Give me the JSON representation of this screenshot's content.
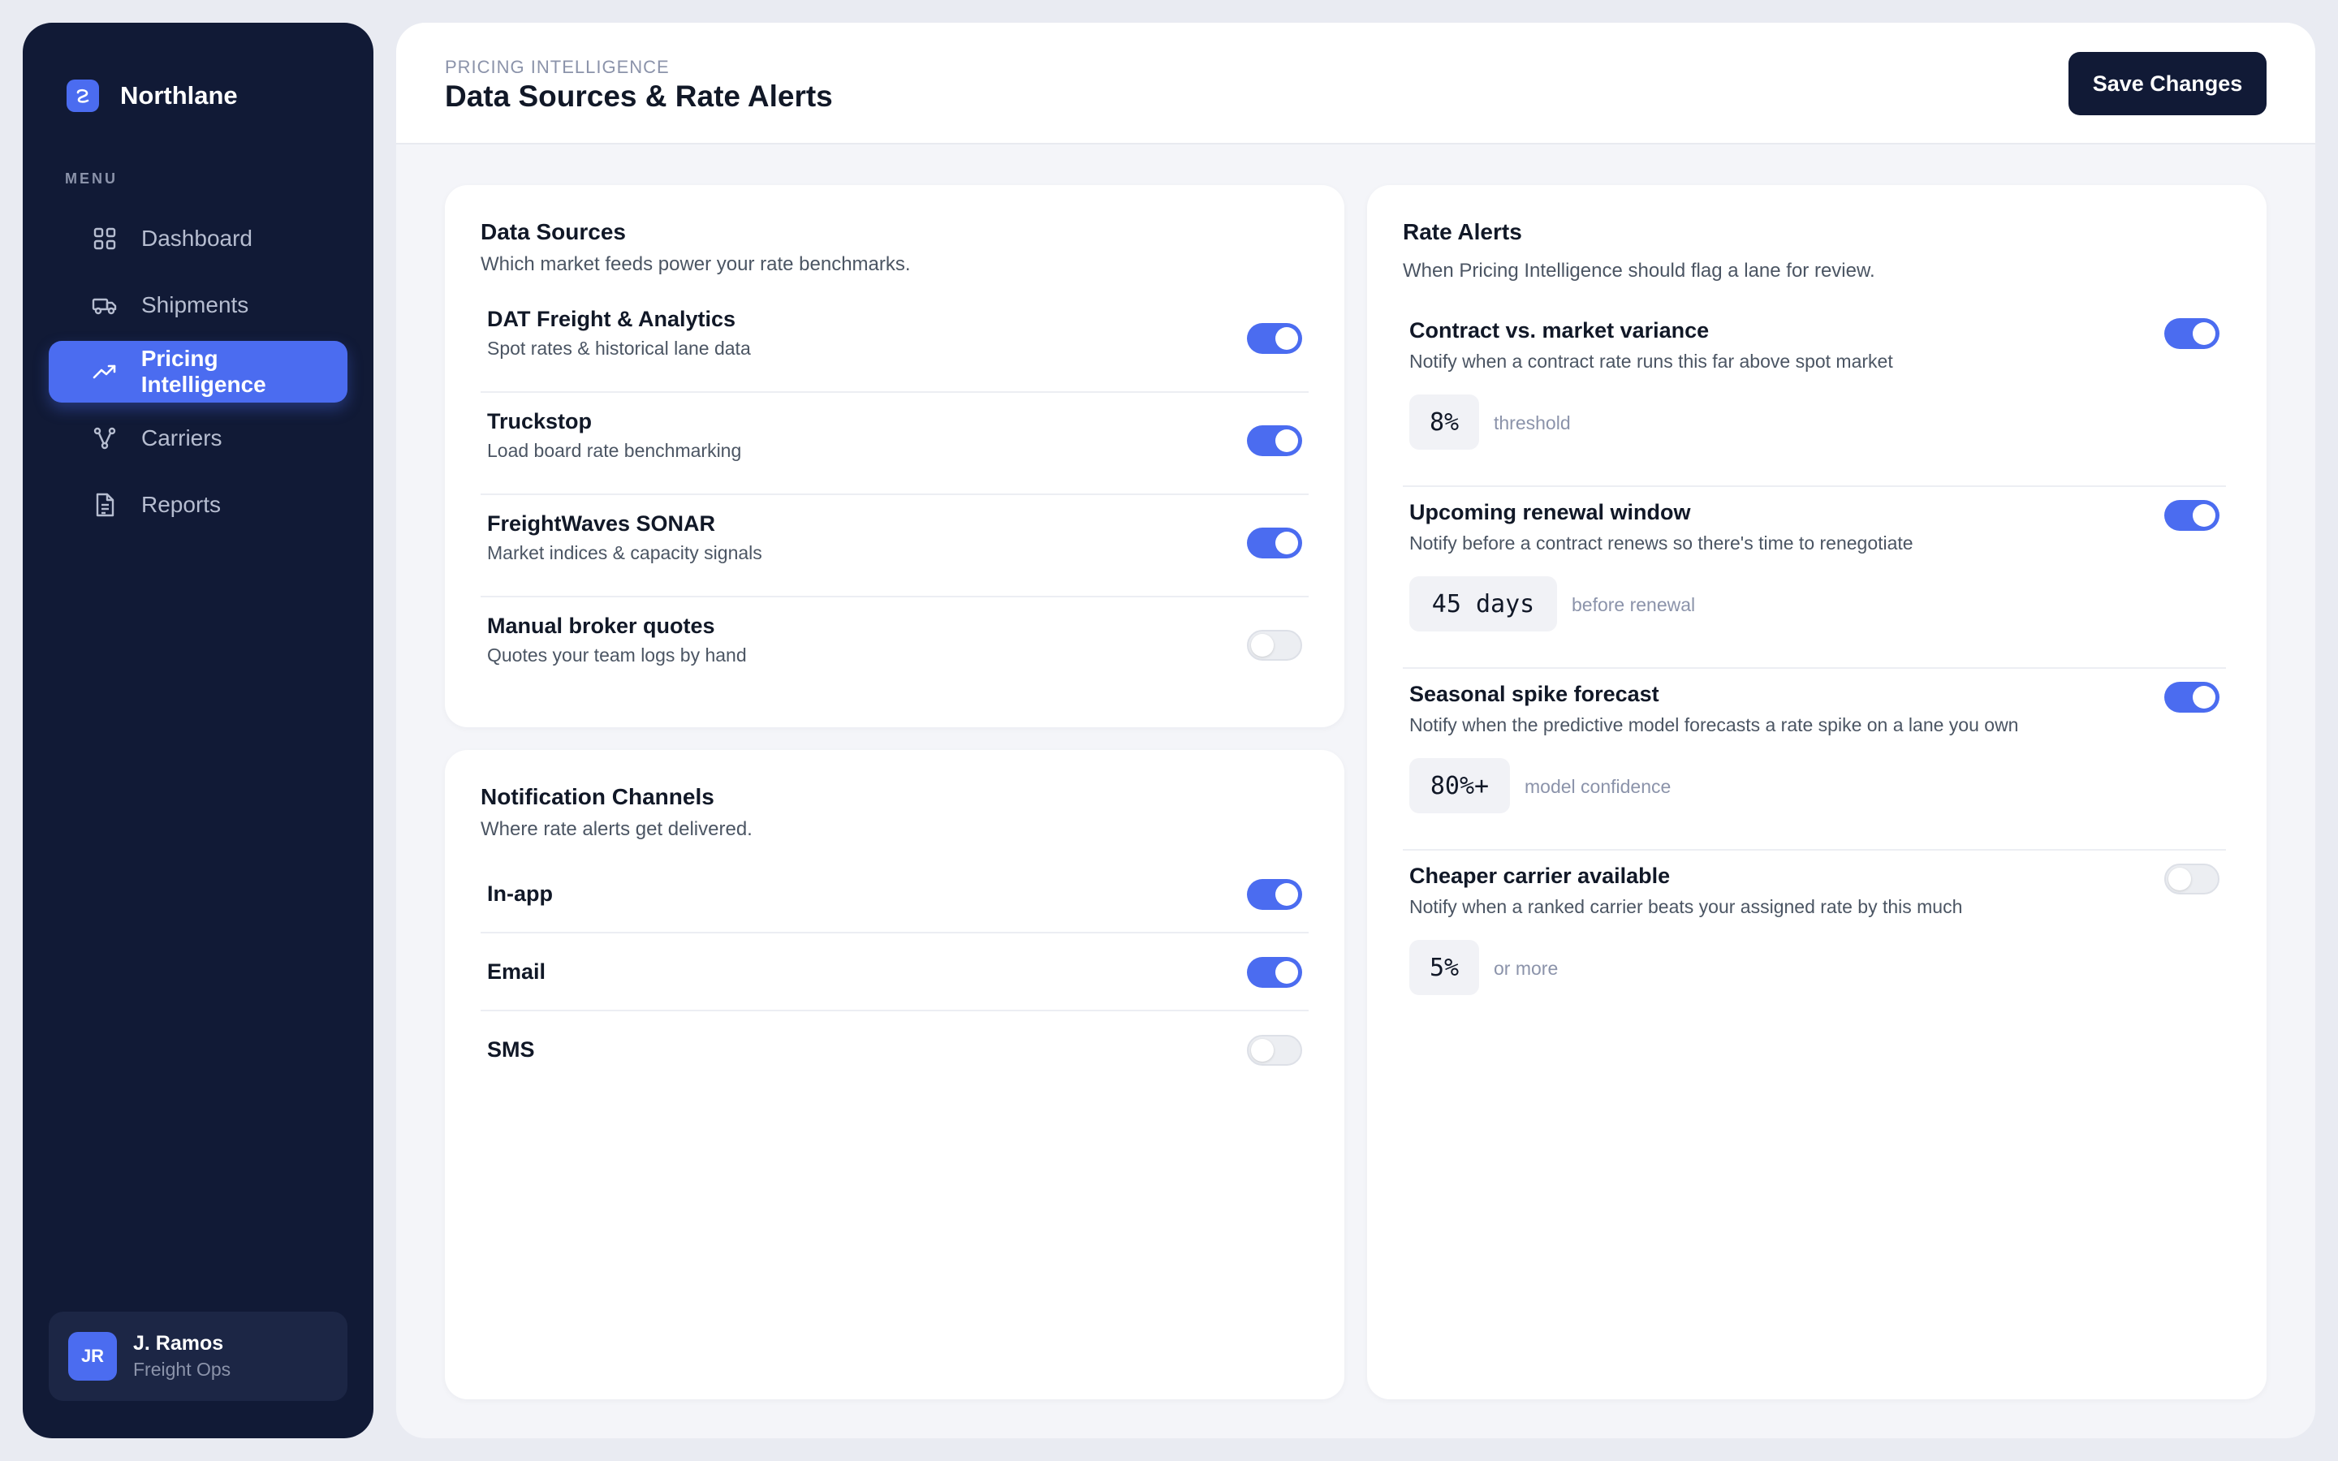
{
  "brand": {
    "name": "Northlane"
  },
  "sidebar": {
    "menu_label": "MENU",
    "items": [
      {
        "label": "Dashboard",
        "icon": "grid-icon",
        "active": false
      },
      {
        "label": "Shipments",
        "icon": "truck-icon",
        "active": false
      },
      {
        "label": "Pricing Intelligence",
        "icon": "trending-up-icon",
        "active": true
      },
      {
        "label": "Carriers",
        "icon": "network-icon",
        "active": false
      },
      {
        "label": "Reports",
        "icon": "document-icon",
        "active": false
      }
    ],
    "user": {
      "initials": "JR",
      "name": "J. Ramos",
      "role": "Freight Ops"
    }
  },
  "header": {
    "eyebrow": "PRICING INTELLIGENCE",
    "title": "Data Sources & Rate Alerts",
    "save_label": "Save Changes"
  },
  "data_sources": {
    "title": "Data Sources",
    "subtitle": "Which market feeds power your rate benchmarks.",
    "items": [
      {
        "name": "DAT Freight & Analytics",
        "desc": "Spot rates & historical lane data",
        "enabled": true
      },
      {
        "name": "Truckstop",
        "desc": "Load board rate benchmarking",
        "enabled": true
      },
      {
        "name": "FreightWaves SONAR",
        "desc": "Market indices & capacity signals",
        "enabled": true
      },
      {
        "name": "Manual broker quotes",
        "desc": "Quotes your team logs by hand",
        "enabled": false
      }
    ]
  },
  "channels": {
    "title": "Notification Channels",
    "subtitle": "Where rate alerts get delivered.",
    "items": [
      {
        "name": "In-app",
        "enabled": true
      },
      {
        "name": "Email",
        "enabled": true
      },
      {
        "name": "SMS",
        "enabled": false
      }
    ]
  },
  "rate_alerts": {
    "title": "Rate Alerts",
    "subtitle": "When Pricing Intelligence should flag a lane for review.",
    "items": [
      {
        "name": "Contract vs. market variance",
        "desc": "Notify when a contract rate runs this far above spot market",
        "value": "8%",
        "suffix": "threshold",
        "enabled": true
      },
      {
        "name": "Upcoming renewal window",
        "desc": "Notify before a contract renews so there's time to renegotiate",
        "value": "45 days",
        "suffix": "before renewal",
        "enabled": true
      },
      {
        "name": "Seasonal spike forecast",
        "desc": "Notify when the predictive model forecasts a rate spike on a lane you own",
        "value": "80%+",
        "suffix": "model confidence",
        "enabled": true
      },
      {
        "name": "Cheaper carrier available",
        "desc": "Notify when a ranked carrier beats your assigned rate by this much",
        "value": "5%",
        "suffix": "or more",
        "enabled": false
      }
    ]
  },
  "colors": {
    "accent": "#4b6cf0",
    "sidebar_bg": "#111a36",
    "toggle_off": "#eceef2"
  }
}
